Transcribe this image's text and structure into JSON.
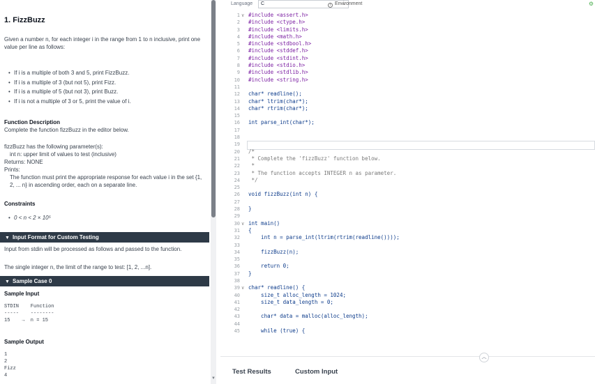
{
  "problem": {
    "title": "1. FizzBuzz",
    "intro": "Given a number n, for each integer i in the range from 1 to n inclusive, print one value per line as follows:",
    "rules": [
      "If i is a multiple of both 3 and 5, print FizzBuzz.",
      "If i is a multiple of 3 (but not 5), print Fizz.",
      "If i is a multiple of 5 (but not 3), print Buzz.",
      "If i is not a multiple of 3 or 5, print the value of i."
    ],
    "function_description_heading": "Function Description",
    "function_description": "Complete the function fizzBuzz in the editor below.",
    "parameters_heading": "fizzBuzz has the following parameter(s):",
    "parameter": "int n:  upper limit of values to test (inclusive)",
    "returns": "Returns:  NONE",
    "prints_heading": "Prints:",
    "prints": "The function must print the appropriate response for each value i in the set {1, 2, ... n} in ascending order, each on a separate line.",
    "constraints_heading": "Constraints",
    "constraint": "0 < n < 2 × 10⁵",
    "input_format_bar": "Input Format for Custom Testing",
    "input_format_text1": "Input from stdin will be processed as follows and passed to the function.",
    "input_format_text2": "The single integer n, the limit of the range to test: [1, 2, ...n].",
    "sample_case_bar": "Sample Case 0",
    "sample_input_heading": "Sample Input",
    "sample_input": "STDIN    Function\n-----    --------\n15    →  n = 15",
    "sample_output_heading": "Sample Output",
    "sample_output": "1\n2\nFizz\n4"
  },
  "editor": {
    "language_label": "Language",
    "language_value": "C",
    "environment_label": "Environment",
    "lines": [
      {
        "n": "1",
        "fold": "∨",
        "text": "#include <assert.h>"
      },
      {
        "n": "2",
        "text": "#include <ctype.h>"
      },
      {
        "n": "3",
        "text": "#include <limits.h>"
      },
      {
        "n": "4",
        "text": "#include <math.h>"
      },
      {
        "n": "5",
        "text": "#include <stdbool.h>"
      },
      {
        "n": "6",
        "text": "#include <stddef.h>"
      },
      {
        "n": "7",
        "text": "#include <stdint.h>"
      },
      {
        "n": "8",
        "text": "#include <stdio.h>"
      },
      {
        "n": "9",
        "text": "#include <stdlib.h>"
      },
      {
        "n": "10",
        "text": "#include <string.h>"
      },
      {
        "n": "11",
        "text": ""
      },
      {
        "n": "12",
        "text": "char* readline();",
        "kind": "plain"
      },
      {
        "n": "13",
        "text": "char* ltrim(char*);",
        "kind": "plain"
      },
      {
        "n": "14",
        "text": "char* rtrim(char*);",
        "kind": "plain"
      },
      {
        "n": "15",
        "text": ""
      },
      {
        "n": "16",
        "text": "int parse_int(char*);",
        "kind": "plain"
      },
      {
        "n": "17",
        "text": ""
      },
      {
        "n": "18",
        "text": ""
      },
      {
        "n": "19",
        "text": "",
        "kind": "active"
      },
      {
        "n": "20",
        "text": "/*",
        "kind": "cmt"
      },
      {
        "n": "21",
        "text": " * Complete the 'fizzBuzz' function below.",
        "kind": "cmt"
      },
      {
        "n": "22",
        "text": " *",
        "kind": "cmt"
      },
      {
        "n": "23",
        "text": " * The function accepts INTEGER n as parameter.",
        "kind": "cmt"
      },
      {
        "n": "24",
        "text": " */",
        "kind": "cmt"
      },
      {
        "n": "25",
        "text": ""
      },
      {
        "n": "26",
        "text": "void fizzBuzz(int n) {",
        "kind": "plain"
      },
      {
        "n": "27",
        "text": ""
      },
      {
        "n": "28",
        "text": "}",
        "kind": "plain"
      },
      {
        "n": "29",
        "text": ""
      },
      {
        "n": "30",
        "fold": "∨",
        "text": "int main()",
        "kind": "plain"
      },
      {
        "n": "31",
        "text": "{",
        "kind": "plain"
      },
      {
        "n": "32",
        "text": "    int n = parse_int(ltrim(rtrim(readline())));",
        "kind": "plain"
      },
      {
        "n": "33",
        "text": ""
      },
      {
        "n": "34",
        "text": "    fizzBuzz(n);",
        "kind": "plain"
      },
      {
        "n": "35",
        "text": ""
      },
      {
        "n": "36",
        "text": "    return 0;",
        "kind": "plain"
      },
      {
        "n": "37",
        "text": "}",
        "kind": "plain"
      },
      {
        "n": "38",
        "text": ""
      },
      {
        "n": "39",
        "fold": "∨",
        "text": "char* readline() {",
        "kind": "plain"
      },
      {
        "n": "40",
        "text": "    size_t alloc_length = 1024;",
        "kind": "plain"
      },
      {
        "n": "41",
        "text": "    size_t data_length = 0;",
        "kind": "plain"
      },
      {
        "n": "42",
        "text": ""
      },
      {
        "n": "43",
        "text": "    char* data = malloc(alloc_length);",
        "kind": "plain"
      },
      {
        "n": "44",
        "text": ""
      },
      {
        "n": "45",
        "text": "    while (true) {",
        "kind": "plain"
      }
    ]
  },
  "bottom": {
    "tab_results": "Test Results",
    "tab_custom": "Custom Input"
  },
  "icons": {
    "collapse": "chevron-up-icon",
    "language_dropdown": "chevron-down-icon",
    "environment": "info-icon",
    "settings": "settings-icon"
  }
}
